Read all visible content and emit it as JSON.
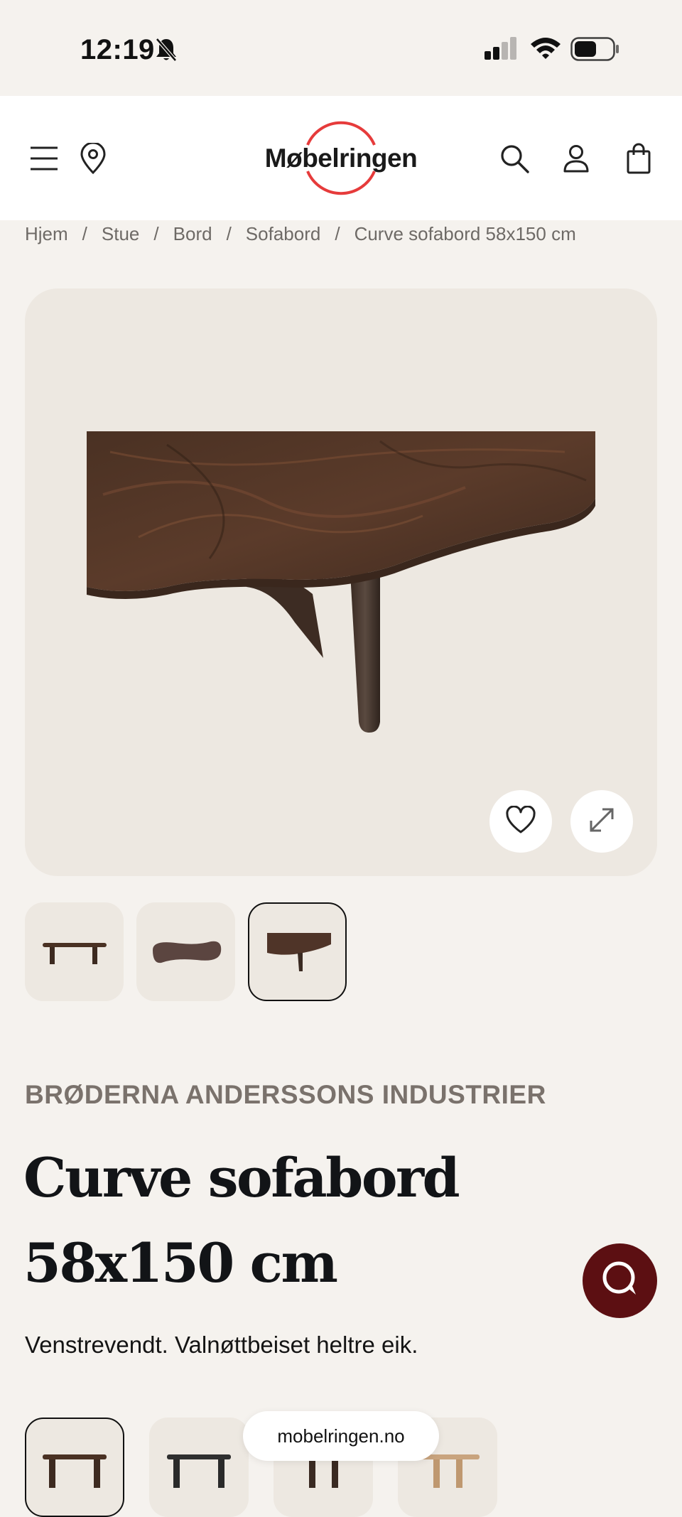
{
  "status_bar": {
    "time": "12:19",
    "icons": [
      "bell-slash-icon",
      "cellular-signal-icon",
      "wifi-icon",
      "battery-icon"
    ]
  },
  "header": {
    "logo_text": "Møbelringen",
    "icons": [
      "menu-icon",
      "location-pin-icon",
      "search-icon",
      "user-icon",
      "shopping-bag-icon"
    ],
    "logo_ring_color": "#e63b3b"
  },
  "breadcrumb": {
    "items": [
      "Hjem",
      "Stue",
      "Bord",
      "Sofabord",
      "Curve sofabord 58x150 cm"
    ],
    "separator": "/"
  },
  "gallery": {
    "buttons": [
      "heart-icon",
      "expand-icon"
    ],
    "selected_thumbnail": 3,
    "thumbnail_count": 3
  },
  "product": {
    "brand": "BRØDERNA ANDERSSONS INDUSTRIER",
    "title": "Curve sofabord 58x150 cm",
    "description": "Venstrevendt. Valnøttbeiset heltre eik."
  },
  "chat": {
    "icon": "chat-bubble-icon",
    "color": "#5c0f12"
  },
  "browser": {
    "url": "mobelringen.no"
  },
  "variants": {
    "selected": 1,
    "visible_count": 4
  }
}
